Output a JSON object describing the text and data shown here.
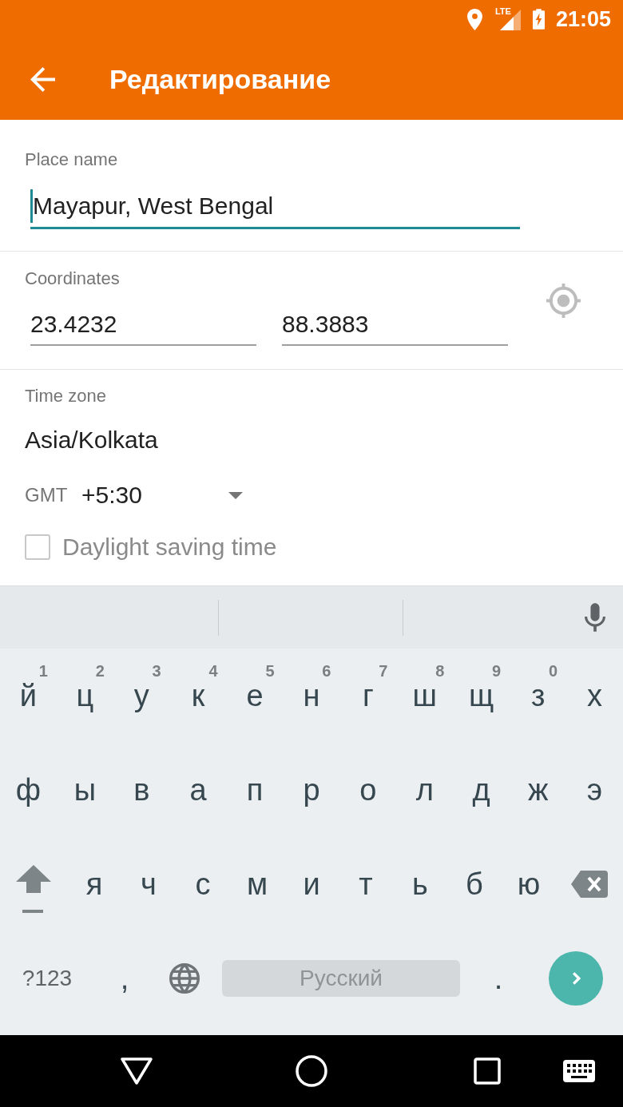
{
  "status_bar": {
    "network_type": "LTE",
    "time": "21:05"
  },
  "app_bar": {
    "title": "Редактирование"
  },
  "place_name": {
    "label": "Place name",
    "value": "Mayapur, West Bengal",
    "focused": true
  },
  "coordinates": {
    "label": "Coordinates",
    "fields": [
      {
        "value": "23.4232",
        "focused": false
      },
      {
        "value": "88.3883",
        "focused": false
      }
    ]
  },
  "time_zone": {
    "label": "Time zone",
    "name": "Asia/Kolkata",
    "gmt_label": "GMT",
    "offset": "+5:30",
    "daylight_saving": {
      "label": "Daylight saving time",
      "checked": false
    }
  },
  "keyboard": {
    "rows": [
      {
        "keys": [
          {
            "label": "й",
            "hint": "1"
          },
          {
            "label": "ц",
            "hint": "2"
          },
          {
            "label": "у",
            "hint": "3"
          },
          {
            "label": "к",
            "hint": "4"
          },
          {
            "label": "е",
            "hint": "5"
          },
          {
            "label": "н",
            "hint": "6"
          },
          {
            "label": "г",
            "hint": "7"
          },
          {
            "label": "ш",
            "hint": "8"
          },
          {
            "label": "щ",
            "hint": "9"
          },
          {
            "label": "з",
            "hint": "0"
          },
          {
            "label": "х"
          }
        ]
      },
      {
        "keys": [
          {
            "label": "ф"
          },
          {
            "label": "ы"
          },
          {
            "label": "в"
          },
          {
            "label": "а"
          },
          {
            "label": "п"
          },
          {
            "label": "р"
          },
          {
            "label": "о"
          },
          {
            "label": "л"
          },
          {
            "label": "д"
          },
          {
            "label": "ж"
          },
          {
            "label": "э"
          }
        ]
      },
      {
        "keys": [
          {
            "kind": "shift"
          },
          {
            "kind": "letter",
            "label": "я"
          },
          {
            "kind": "letter",
            "label": "ч"
          },
          {
            "kind": "letter",
            "label": "с"
          },
          {
            "kind": "letter",
            "label": "м"
          },
          {
            "kind": "letter",
            "label": "и"
          },
          {
            "kind": "letter",
            "label": "т"
          },
          {
            "kind": "letter",
            "label": "ь"
          },
          {
            "kind": "letter",
            "label": "б"
          },
          {
            "kind": "letter",
            "label": "ю"
          },
          {
            "kind": "backspace"
          }
        ]
      },
      {
        "keys": [
          {
            "kind": "symbols",
            "label": "?123"
          },
          {
            "kind": "letter",
            "label": ","
          },
          {
            "kind": "language"
          },
          {
            "kind": "space",
            "label": "Русский"
          },
          {
            "kind": "letter",
            "label": "."
          },
          {
            "kind": "enter"
          }
        ]
      }
    ]
  }
}
